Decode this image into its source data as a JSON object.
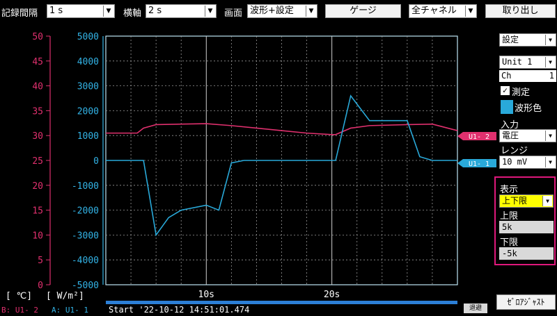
{
  "topbar": {
    "record_interval_label": "記録間隔",
    "record_interval_value": "1 s",
    "timebase_label": "横軸",
    "timebase_value": "2 s",
    "screen_label": "画面",
    "screen_value": "波形+設定",
    "gauge_button": "ゲージ",
    "channel_select_value": "全チャネル",
    "recall_button": "取り出し"
  },
  "sidebar": {
    "mode_select": "設定",
    "unit_select": "Unit 1",
    "ch_label": "Ch",
    "ch_value": "1",
    "measure_checkbox_label": "測定",
    "measure_checked": true,
    "wave_color_label": "波形色",
    "wave_color": "#29a9d9",
    "input_label": "入力",
    "input_value": "電圧",
    "range_label": "レンジ",
    "range_value": "10 mV",
    "display_label": "表示",
    "display_value": "上下限",
    "upper_label": "上限",
    "upper_value": "5k",
    "lower_label": "下限",
    "lower_value": "-5k",
    "zero_adjust_button": "ｾﾞﾛｱｼﾞｬｽﾄ"
  },
  "axes": {
    "left_ticks": [
      "50",
      "45",
      "40",
      "35",
      "30",
      "25",
      "20",
      "15",
      "10",
      "5",
      "0"
    ],
    "left_unit": "[  ℃]",
    "left_color": "#e0306e",
    "right_ticks": [
      "5000",
      "4000",
      "3000",
      "2000",
      "1000",
      "0",
      "-1000",
      "-2000",
      "-3000",
      "-4000",
      "-5000"
    ],
    "right_unit": "[   W/m²]",
    "right_color": "#33b3e6",
    "x_ticks": [
      "10s",
      "20s"
    ]
  },
  "footer": {
    "legend_b": "B:  U1- 2",
    "legend_a": "A:  U1- 1",
    "start_text": "Start '22-10-12 14:51:01.474",
    "retreat_label": "退避"
  },
  "markers": {
    "u1_2": "U1- 2",
    "u1_1": "U1- 1"
  },
  "chart_data": {
    "type": "line",
    "x_unit": "s",
    "xlim": [
      0,
      28
    ],
    "series": [
      {
        "name": "U1- 2",
        "color": "#e0306e",
        "axis": "left",
        "ylim": [
          0,
          50
        ],
        "x": [
          0,
          2.5,
          3,
          4,
          8,
          10,
          12,
          14,
          16,
          18,
          18.3,
          19.5,
          21,
          24,
          26,
          28
        ],
        "y": [
          30.5,
          30.5,
          31.5,
          32.2,
          32.4,
          32,
          31.5,
          31,
          30.5,
          30.2,
          30.2,
          31.5,
          32,
          32.2,
          32.3,
          31
        ]
      },
      {
        "name": "U1- 1",
        "color": "#29a9d9",
        "axis": "right",
        "ylim": [
          -5000,
          5000
        ],
        "x": [
          0,
          2.5,
          3,
          4,
          5,
          6,
          8,
          9,
          10,
          11,
          12,
          18.3,
          19.5,
          21,
          24,
          25,
          26,
          28
        ],
        "y": [
          0,
          0,
          0,
          -3000,
          -2300,
          -2000,
          -1800,
          -2000,
          -100,
          0,
          0,
          0,
          2600,
          1600,
          1600,
          150,
          0,
          0
        ]
      }
    ]
  }
}
